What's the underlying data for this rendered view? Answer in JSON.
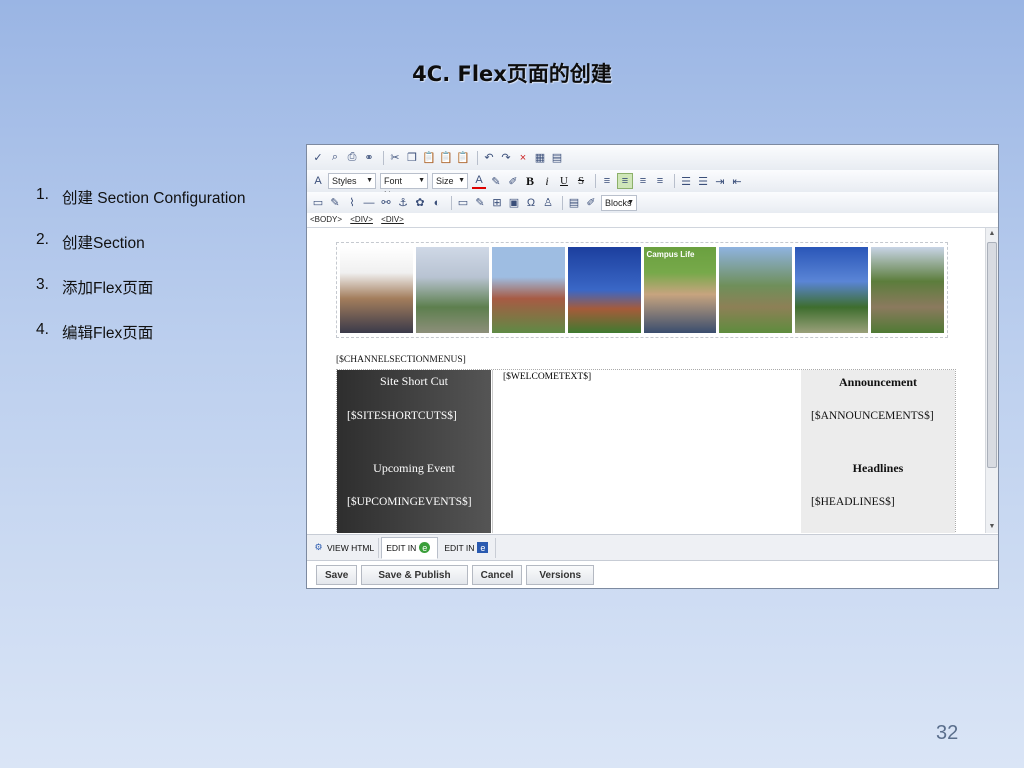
{
  "slide": {
    "title": "4C. Flex页面的创建",
    "page_number": "32",
    "steps": [
      {
        "num": "1.",
        "text": "创建 Section Configuration"
      },
      {
        "num": "2.",
        "text": "创建Section"
      },
      {
        "num": "3.",
        "text": "添加Flex页面"
      },
      {
        "num": "4.",
        "text": "编辑Flex页面"
      }
    ]
  },
  "editor": {
    "toolbar2": {
      "styles": "Styles",
      "font_name": "Font Name",
      "size": "Size",
      "bold": "B",
      "italic": "i",
      "underline": "U",
      "strike": "S"
    },
    "toolbar3": {
      "blocks": "Blocks"
    },
    "path": [
      "<BODY>",
      "<DIV>",
      "<DIV>"
    ],
    "content": {
      "campus_label": "Campus Life",
      "menus_tag": "[$CHANNELSECTIONMENUS]",
      "left": {
        "site_short_cut": "Site Short Cut",
        "site_short_cuts_tag": "[$SITESHORTCUTS$]",
        "upcoming_event": "Upcoming Event",
        "upcoming_events_tag": "[$UPCOMINGEVENTS$]"
      },
      "middle": {
        "welcome_tag": "[$WELCOMETEXT$]"
      },
      "right": {
        "announcement": "Announcement",
        "announcements_tag": "[$ANNOUNCEMENTS$]",
        "headlines": "Headlines",
        "headlines_tag": "[$HEADLINES$]"
      }
    },
    "tabs": {
      "view_html": "VIEW HTML",
      "edit_in_1": "EDIT IN",
      "edit_in_2": "EDIT IN"
    },
    "buttons": {
      "save": "Save",
      "save_publish": "Save & Publish",
      "cancel": "Cancel",
      "versions": "Versions"
    }
  }
}
